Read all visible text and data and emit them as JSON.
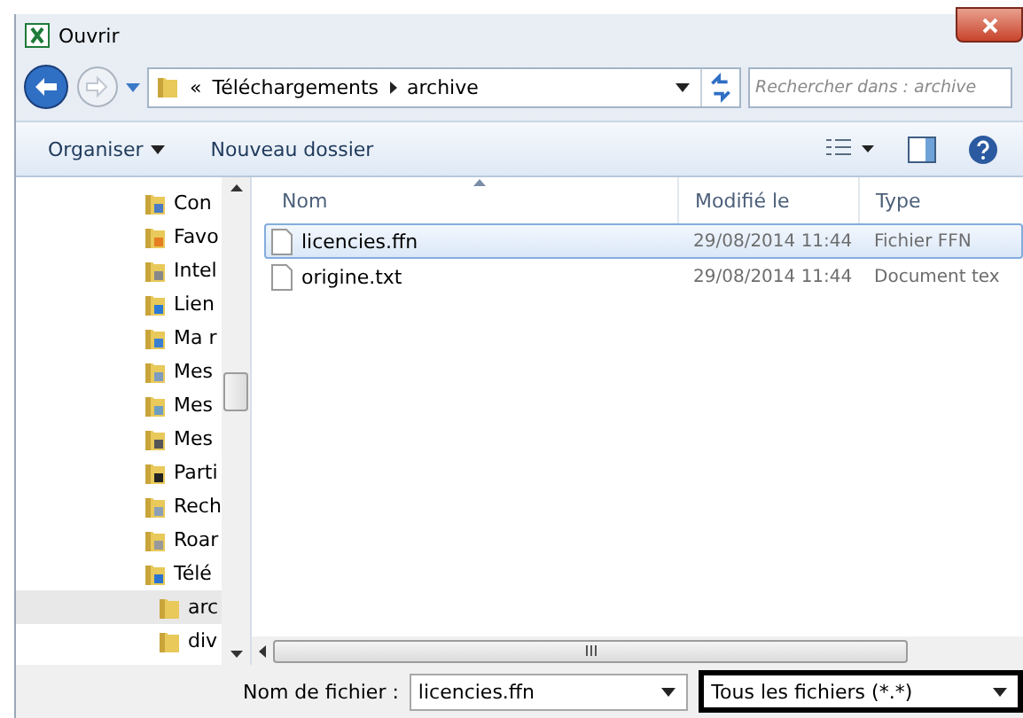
{
  "window": {
    "title": "Ouvrir"
  },
  "address": {
    "overflow": "«",
    "segments": [
      "Téléchargements",
      "archive"
    ]
  },
  "search": {
    "placeholder": "Rechercher dans : archive"
  },
  "toolbar": {
    "buttons": [
      {
        "label": "Organiser",
        "kind": "menu"
      },
      {
        "label": "Nouveau dossier",
        "kind": "plain"
      }
    ]
  },
  "tree": [
    {
      "label": "Con",
      "selected": false
    },
    {
      "label": "Favo",
      "selected": false
    },
    {
      "label": "Intel",
      "selected": false
    },
    {
      "label": "Lien",
      "selected": false
    },
    {
      "label": "Ma r",
      "selected": false
    },
    {
      "label": "Mes",
      "selected": false
    },
    {
      "label": "Mes",
      "selected": false
    },
    {
      "label": "Mes",
      "selected": false
    },
    {
      "label": "Parti",
      "selected": false
    },
    {
      "label": "Rech",
      "selected": false
    },
    {
      "label": "Roar",
      "selected": false
    },
    {
      "label": "Télé",
      "selected": false,
      "children": [
        {
          "label": "arc",
          "selected": true
        },
        {
          "label": "div",
          "selected": false
        }
      ]
    }
  ],
  "table": {
    "columns": [
      "Nom",
      "Modifié le",
      "Type"
    ],
    "rows": [
      {
        "name": "licencies.ffn",
        "modified": "29/08/2014 11:44",
        "type": "Fichier FFN",
        "selected": true
      },
      {
        "name": "origine.txt",
        "modified": "29/08/2014 11:44",
        "type": "Document tex",
        "selected": false
      }
    ]
  },
  "footer": {
    "filename_label": "Nom de fichier :",
    "filename": "licencies.ffn",
    "filetype": "Tous les fichiers (*.*)"
  }
}
